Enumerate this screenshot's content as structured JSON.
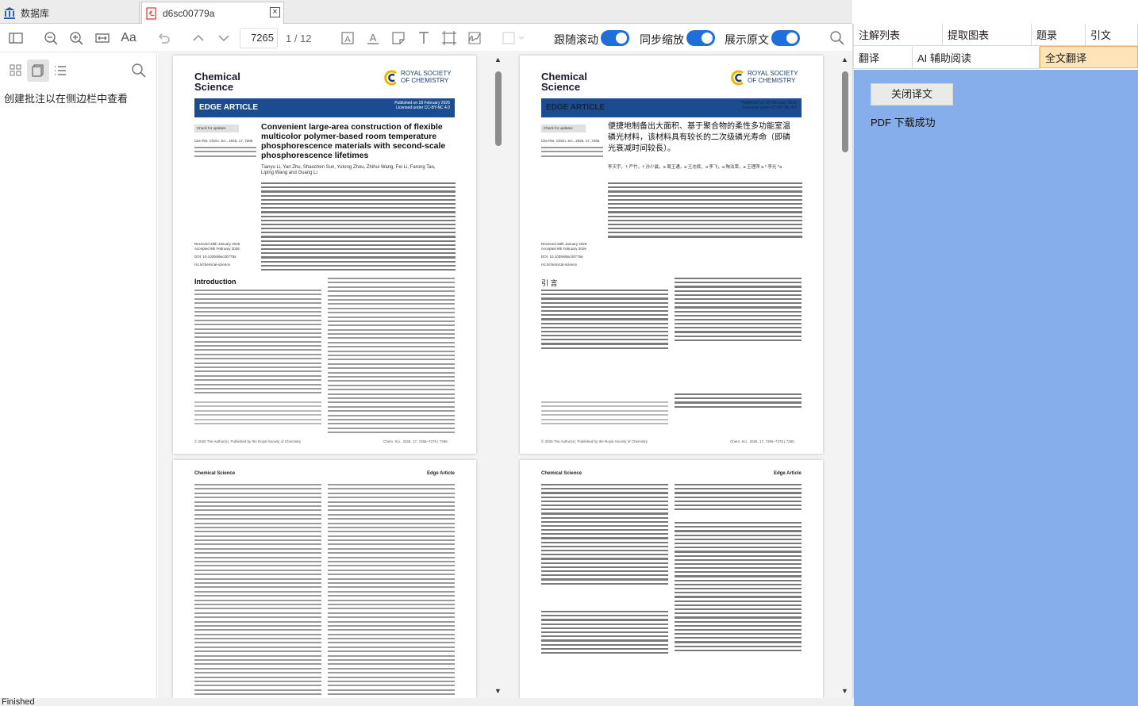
{
  "tabs": {
    "database_label": "数据库",
    "document_label": "d6sc00779a",
    "close_symbol": "×"
  },
  "toolbar": {
    "page_current": "7265",
    "page_total": "1 / 12",
    "font_label": "Aa",
    "toggle_follow_scroll": "跟随滚动",
    "toggle_sync_zoom": "同步缩放",
    "toggle_show_original": "展示原文"
  },
  "left_panel": {
    "hint": "创建批注以在侧边栏中查看"
  },
  "right_panel": {
    "tabs_row1": [
      "注解列表",
      "提取图表",
      "题录",
      "引文"
    ],
    "tabs_row2": [
      "翻译",
      "AI 辅助阅读",
      "全文翻译"
    ],
    "close_translation": "关闭译文",
    "status": "PDF 下载成功"
  },
  "status_bar": {
    "text": "Finished"
  },
  "pages": {
    "journal_line1": "Chemical",
    "journal_line2": "Science",
    "rsc_line1": "ROYAL SOCIETY",
    "rsc_line2": "OF CHEMISTRY",
    "article_type": "EDGE ARTICLE",
    "published": "Published on 18 February 2026",
    "license": "Licensed under CC-BY-NC 4.0",
    "check_updates": "Check for updates",
    "cite": "Cite this: Chem. Sci., 2026, 17, 7265",
    "title_en": "Convenient large-area construction of flexible multicolor polymer-based room temperature phosphorescence materials with second-scale phosphorescence lifetimes",
    "title_zh": "便捷地制备出大面积、基于聚合物的柔性多功能室温磷光材料，该材料具有较长的二次级磷光寿命（即磷光衰减时间较長）。",
    "authors_en": "Tianyu Li, Yan Zhu, Shaochen Sun, Yutong Zhou, Zhihui Wang, Fei Li, Farong Tao, Liping Wang and Guang Li",
    "authors_zh": "李天宇，† 严竹，† 孙少晨，a 周王通，a 王志辉，a 李飞，a 陶法荣，a 王理萍 a * 李光 *a",
    "received": "Received 28th January 2026",
    "accepted": "Accepted 9th February 2026",
    "doi": "DOI: 10.1039/d6sc00779a",
    "site": "rsc.li/chemical-science",
    "intro_en": "Introduction",
    "intro_zh": "引 言",
    "footer": "© 2026 The Author(s). Published by the Royal Society of Chemistry",
    "footer_right": "Chem. Sci., 2026, 17, 7265–7276 | 7265",
    "header_journal": "Chemical Science",
    "header_type": "Edge Article"
  }
}
